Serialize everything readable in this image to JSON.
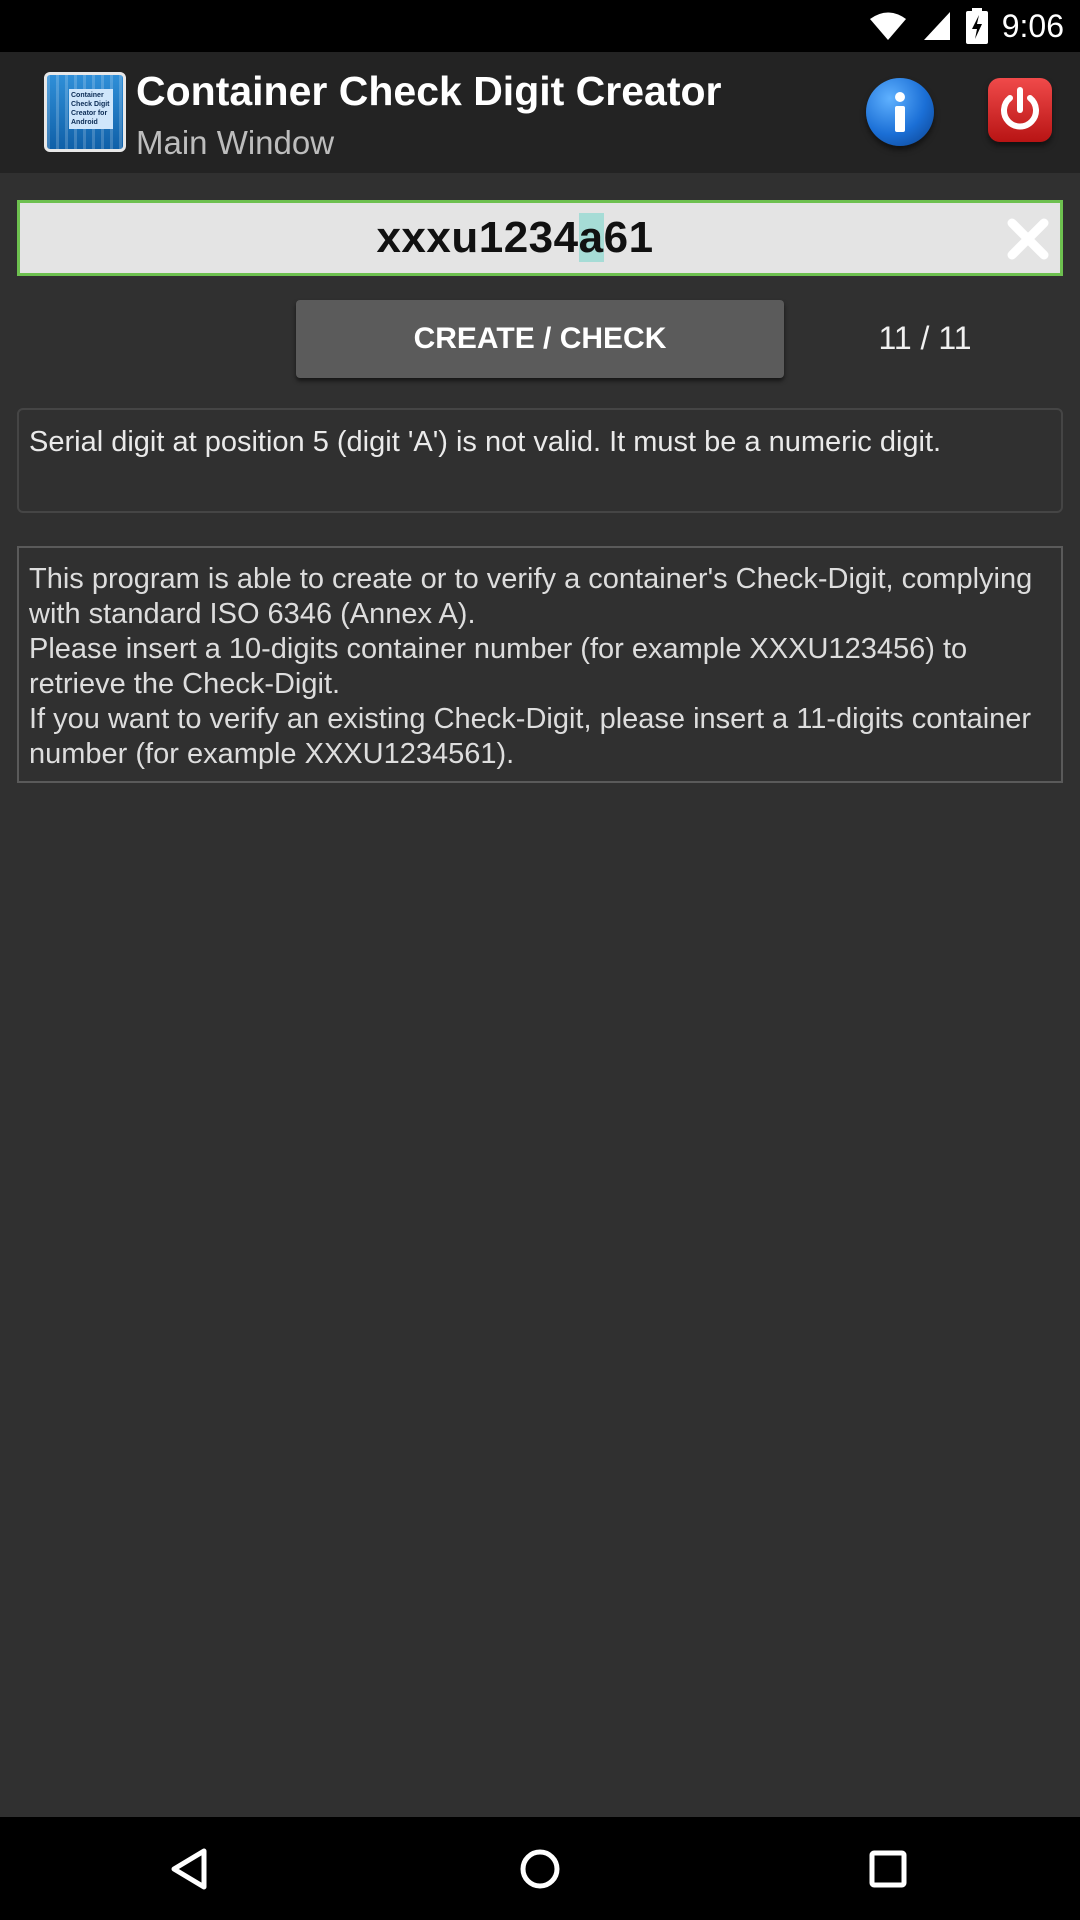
{
  "status_bar": {
    "time": "9:06",
    "icons": [
      "wifi-icon",
      "cellular-signal-icon",
      "battery-charging-icon"
    ]
  },
  "app_bar": {
    "logo_text": "Container Check Digit Creator for Android",
    "title": "Container Check Digit Creator",
    "subtitle": "Main Window",
    "icons": [
      "info-icon",
      "power-icon"
    ]
  },
  "input": {
    "value_before": "xxxu1234",
    "value_selected": "a",
    "value_after": "61",
    "clear_icon": "close-icon"
  },
  "actions": {
    "create_check_label": "CREATE / CHECK",
    "counter": "11 / 11"
  },
  "message": {
    "text": "Serial digit at position 5 (digit 'A') is not valid. It must be a numeric digit."
  },
  "info": {
    "lines": [
      "This program is able to create or to verify a container's Check-Digit, complying with standard ISO 6346 (Annex A).",
      "Please insert a 10-digits container number (for example XXXU123456) to retrieve the Check-Digit.",
      "If you want to verify an existing Check-Digit, please insert a 11-digits container number (for example XXXU1234561)."
    ]
  },
  "nav_bar": {
    "icons": [
      "back-icon",
      "home-icon",
      "recents-icon"
    ]
  },
  "colors": {
    "background": "#303030",
    "app_bar": "#232323",
    "input_border": "#6dc04f",
    "button": "#5b5b5b",
    "info_blue": "#1b6fd6",
    "power_red": "#d42020"
  }
}
